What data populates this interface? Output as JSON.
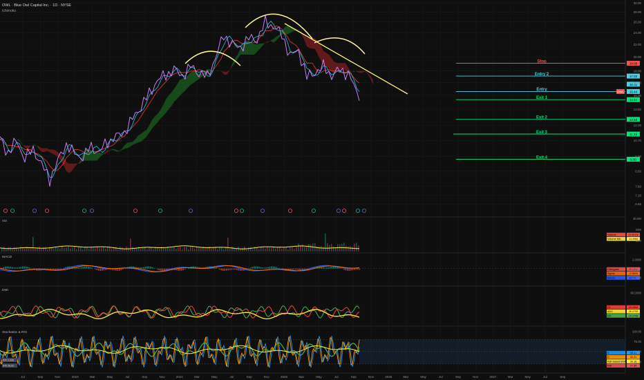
{
  "header": {
    "symbol_line": "OWL · Blue Owl Capital Inc. · 1D · NYSE",
    "indicator": "Ichimoku"
  },
  "colors": {
    "bg": "#0f0f0f",
    "grid": "#1d1d1d",
    "price": "#c77dff",
    "tenkan": "#26c6da",
    "kijun": "#e53935",
    "cloud_bull": "#1b5e20",
    "cloud_bear": "#7f1d1d",
    "hs_curve": "#fff59d",
    "trend": "#fff176",
    "stop": "#ef5350",
    "entry": "#4dd0e1",
    "exit": "#00e676",
    "volume_ma": "#ffeb3b",
    "macd": "#2962ff",
    "signal": "#ff6d00",
    "dmi_plus": "#4caf50",
    "dmi_minus": "#f44336",
    "adx": "#ffeb3b",
    "stoch_k": "#2196f3",
    "stoch_d": "#ff9800",
    "rsi": "#4caf50",
    "rsi_ema": "#ffeb3b"
  },
  "chart_data": [
    {
      "type": "line",
      "panel": "price",
      "scale": "log",
      "ylim": [
        6.1,
        30.0
      ],
      "y_ticks": [
        "30.00",
        "28.00",
        "26.00",
        "24.00",
        "22.00",
        "20.00",
        "18.00",
        "16.50",
        "15.00",
        "13.50",
        "12.00",
        "10.70",
        "9.50",
        "8.50",
        "7.60",
        "7.10",
        "6.65"
      ],
      "y_tick_values": [
        30.0,
        28.0,
        26.0,
        24.0,
        22.0,
        20.0,
        18.0,
        16.5,
        15.0,
        13.5,
        12.0,
        10.7,
        9.5,
        8.5,
        7.6,
        7.1,
        6.65
      ],
      "x_ticks": [
        "Jul",
        "Sep",
        "Nov",
        "2023",
        "Mar",
        "May",
        "Jul",
        "Sep",
        "Nov",
        "2024",
        "Mar",
        "May",
        "Jul",
        "Sep",
        "Nov",
        "2025",
        "Mar",
        "May",
        "Jul",
        "Sep",
        "Nov",
        "2026",
        "Mar",
        "May",
        "Jul",
        "Sep",
        "Nov",
        "2027",
        "Mar",
        "May",
        "Jul",
        "Sep"
      ],
      "price_anchors": [
        [
          0,
          10.8
        ],
        [
          3,
          9.8
        ],
        [
          6,
          10.6
        ],
        [
          9,
          9.4
        ],
        [
          12,
          10.0
        ],
        [
          15,
          9.0
        ],
        [
          18,
          8.0
        ],
        [
          21,
          9.2
        ],
        [
          24,
          10.4
        ],
        [
          27,
          9.7
        ],
        [
          30,
          9.5
        ],
        [
          33,
          10.2
        ],
        [
          36,
          9.8
        ],
        [
          39,
          10.6
        ],
        [
          42,
          11.0
        ],
        [
          45,
          11.4
        ],
        [
          48,
          12.6
        ],
        [
          51,
          13.8
        ],
        [
          54,
          15.2
        ],
        [
          57,
          16.8
        ],
        [
          60,
          17.5
        ],
        [
          63,
          18.2
        ],
        [
          66,
          17.4
        ],
        [
          69,
          18.6
        ],
        [
          72,
          17.8
        ],
        [
          75,
          17.2
        ],
        [
          78,
          20.0
        ],
        [
          81,
          23.5
        ],
        [
          84,
          22.0
        ],
        [
          87,
          21.5
        ],
        [
          90,
          23.0
        ],
        [
          93,
          22.8
        ],
        [
          96,
          25.9
        ],
        [
          99,
          25.2
        ],
        [
          102,
          23.5
        ],
        [
          105,
          20.2
        ],
        [
          108,
          21.0
        ],
        [
          111,
          17.2
        ],
        [
          114,
          17.8
        ],
        [
          117,
          18.6
        ],
        [
          120,
          17.4
        ],
        [
          123,
          18.2
        ],
        [
          126,
          17.6
        ],
        [
          129,
          15.4
        ],
        [
          130,
          15.1
        ]
      ],
      "series": [
        {
          "name": "Close",
          "values": [
            10.8,
            10.5,
            10.0,
            9.8,
            10.1,
            10.4,
            10.6,
            10.2,
            9.7,
            9.4,
            9.6,
            9.8,
            10.0,
            9.7,
            9.3,
            9.0,
            8.6,
            8.3,
            8.0,
            8.4,
            8.8,
            9.2,
            9.6,
            10.0,
            10.4,
            10.2,
            9.9,
            9.7,
            9.6,
            9.5,
            9.5,
            9.7,
            10.0,
            10.2,
            10.1,
            9.9,
            9.8,
            10.1,
            10.4,
            10.6,
            10.7,
            10.9,
            11.0,
            11.1,
            11.3,
            11.4,
            11.8,
            12.2,
            12.6,
            13.0,
            13.4,
            13.8,
            14.3,
            14.7,
            15.2,
            15.7,
            16.3,
            16.8,
            17.0,
            17.3,
            17.5,
            17.7,
            18.0,
            18.2,
            17.9,
            17.6,
            17.4,
            17.8,
            18.2,
            18.6,
            18.3,
            18.0,
            17.8,
            17.6,
            17.4,
            17.2,
            18.1,
            19.0,
            20.0,
            21.1,
            22.3,
            23.5,
            23.0,
            22.5,
            22.0,
            21.8,
            21.7,
            21.5,
            22.0,
            22.5,
            23.0,
            22.9,
            22.9,
            22.8,
            23.8,
            24.8,
            25.9,
            25.7,
            25.4,
            25.2,
            24.6,
            24.1,
            23.5,
            22.4,
            21.3,
            20.2,
            20.5,
            20.7,
            21.0,
            19.7,
            18.5,
            17.2,
            17.4,
            17.6,
            17.8,
            18.1,
            18.3,
            18.6,
            18.2,
            17.8,
            17.4,
            17.7,
            17.9,
            18.2,
            18.0,
            17.8,
            17.6,
            16.9,
            16.1,
            15.4,
            15.1
          ]
        },
        {
          "name": "Tenkan-sen",
          "values": []
        },
        {
          "name": "Kijun-sen",
          "values": []
        }
      ],
      "levels": [
        {
          "label": "Stop",
          "value": 19.08,
          "color_key": "stop",
          "badge": "19.08"
        },
        {
          "label": "Entry 2",
          "value": 17.33,
          "color_key": "entry",
          "badge": "17.33"
        },
        {
          "label": "",
          "value": 16.31,
          "color_key": "entry",
          "badge": "16.31"
        },
        {
          "label": "Entry",
          "value": 15.44,
          "color_key": "entry",
          "badge": "15.44",
          "owl_tag": "OWL"
        },
        {
          "label": "Exit 1",
          "value": 14.53,
          "color_key": "exit",
          "badge": "14.53"
        },
        {
          "label": "Exit 2",
          "value": 12.53,
          "color_key": "exit",
          "badge": "12.53"
        },
        {
          "label": "Exit 3",
          "value": 11.23,
          "color_key": "exit",
          "badge": "11.23"
        },
        {
          "label": "Exit 4",
          "value": 9.3,
          "color_key": "exit",
          "badge": "9.30"
        }
      ]
    },
    {
      "type": "bar",
      "panel": "volume",
      "title": "Vol",
      "ylim": [
        0,
        30000000
      ],
      "y_ticks": [
        "30.0M",
        "20M",
        "10M"
      ],
      "y_tick_values": [
        30000000,
        20000000,
        10000000
      ],
      "series": [
        {
          "name": "Volume MA",
          "values": []
        }
      ],
      "labels": [
        {
          "text": "Volume",
          "value": "14.851M",
          "color_key": "stop"
        },
        {
          "text": "Volume MA",
          "value": "11.49M",
          "color_key": "volume_ma"
        }
      ]
    },
    {
      "type": "line",
      "panel": "macd",
      "title": "MACD",
      "ylim": [
        -1.8,
        1.6
      ],
      "y_ticks": [
        "1.0000",
        "0.0000",
        "-1.0000"
      ],
      "y_tick_values": [
        1.0,
        0.0,
        -1.0
      ],
      "labels": [
        {
          "text": "Histogram",
          "value": "-0.1240",
          "color_key": "stop"
        },
        {
          "text": "Signal",
          "value": "-0.5605",
          "color_key": "signal"
        },
        {
          "text": "MACD",
          "value": "-0.6990",
          "color_key": "macd"
        }
      ]
    },
    {
      "type": "line",
      "panel": "dmi",
      "title": "DMI",
      "ylim": [
        0,
        70
      ],
      "y_ticks": [
        "60.0000"
      ],
      "y_tick_values": [
        60.0
      ],
      "labels": [
        {
          "text": "DI-",
          "value": "33.3498",
          "color_key": "dmi_minus"
        },
        {
          "text": "ADX",
          "value": "25.4705",
          "color_key": "adx"
        },
        {
          "text": "DI+",
          "value": "15.1708",
          "color_key": "dmi_plus"
        }
      ]
    },
    {
      "type": "line",
      "panel": "stoch_rsi",
      "title": "Stochastic & RSI",
      "ylim": [
        0,
        110
      ],
      "y_ticks": [
        "100.00",
        "75.00",
        "50.00",
        "25.00"
      ],
      "y_tick_values": [
        100,
        75,
        50,
        25
      ],
      "labels": [
        {
          "text": "K",
          "value": "45.41",
          "color_key": "stoch_k"
        },
        {
          "text": "D",
          "value": "40.31",
          "color_key": "stoch_d"
        },
        {
          "text": "RSI-based EMA",
          "value": "36.16",
          "color_key": "rsi_ema"
        },
        {
          "text": "RSI",
          "value": "27.35",
          "color_key": "stop"
        }
      ],
      "corner_labels": [
        "RPI 0.608",
        "RPI 28.02"
      ]
    }
  ]
}
